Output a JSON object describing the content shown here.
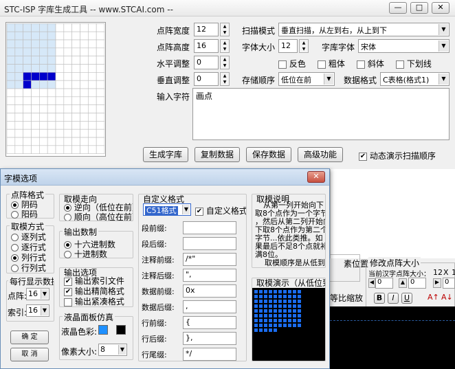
{
  "window": {
    "title": "STC-ISP 字库生成工具 -- www.STCAI.com --",
    "min": "—",
    "max": "□",
    "close": "✕"
  },
  "settings": {
    "width_label": "点阵宽度",
    "width_value": "12",
    "height_label": "点阵高度",
    "height_value": "16",
    "hadj_label": "水平调整",
    "hadj_value": "0",
    "vadj_label": "垂直调整",
    "vadj_value": "0",
    "scan_label": "扫描模式",
    "scan_value": "垂直扫描，从左到右，从上到下",
    "fontsize_label": "字体大小",
    "fontsize_value": "12",
    "font_label": "字库字体",
    "font_value": "宋体",
    "invert_label": "反色",
    "bold_label": "粗体",
    "italic_label": "斜体",
    "underline_label": "下划线",
    "order_label": "存储顺序",
    "order_value": "低位在前",
    "format_label": "数据格式",
    "format_value": "C表格(格式1)",
    "input_label": "输入字符",
    "input_value": "画点",
    "demo_scan_label": "动态演示扫描顺序",
    "demo_scan_checked": "✔"
  },
  "buttons": {
    "generate": "生成字库",
    "copy": "复制数据",
    "save": "保存数据",
    "advanced": "高级功能"
  },
  "behind": {
    "pixel_pos": "素位置",
    "modify_size": "修改点阵大小",
    "current_size": "当前汉字点阵大小：",
    "size_w": "12",
    "size_x": "X",
    "size_h": "1",
    "spin_val": "0",
    "ratio": "等比缩放",
    "b": "B",
    "i": "I",
    "u": "U"
  },
  "dialog": {
    "title": "字模选项",
    "close": "✕",
    "dot_format": {
      "title": "点阵格式",
      "options": [
        "阴码",
        "阳码"
      ]
    },
    "mode": {
      "title": "取模方式",
      "options": [
        "逐列式",
        "逐行式",
        "列行式",
        "行列式"
      ]
    },
    "per_line": {
      "title": "每行显示数据",
      "dot_label": "点阵:",
      "dot_value": "16",
      "index_label": "索引:",
      "index_value": "16"
    },
    "ok": "确 定",
    "cancel": "取 消",
    "direction": {
      "title": "取模走向",
      "options": [
        "逆向（低位在前）",
        "顺向（高位在前）"
      ]
    },
    "base": {
      "title": "输出数制",
      "options": [
        "十六进制数",
        "十进制数"
      ]
    },
    "output": {
      "title": "输出选项",
      "options": [
        "输出索引文件",
        "输出精简格式",
        "输出紧凑格式"
      ],
      "checked": [
        "✔",
        "✔",
        ""
      ]
    },
    "lcd": {
      "title": "液晶面板仿真",
      "color_label": "液晶色彩:",
      "color_a": "#1e90ff",
      "color_b": "#000000",
      "pixsize_label": "像素大小:",
      "pixsize_value": "8"
    },
    "custom": {
      "title": "自定义格式",
      "fmt_value": "C51格式",
      "custom_check_label": "自定义格式",
      "rows": [
        {
          "label": "段前缀:",
          "value": ""
        },
        {
          "label": "段后缀:",
          "value": ""
        },
        {
          "label": "注释前缀:",
          "value": "/*\""
        },
        {
          "label": "注释后缀:",
          "value": "\","
        },
        {
          "label": "数据前缀:",
          "value": "0x"
        },
        {
          "label": "数据后缀:",
          "value": ","
        },
        {
          "label": "行前缀:",
          "value": "{"
        },
        {
          "label": "行后缀:",
          "value": "},"
        },
        {
          "label": "行尾缀:",
          "value": "*/"
        }
      ]
    },
    "desc": {
      "title": "取模说明",
      "text": [
        "从第一列开始向下",
        "取8个点作为一个字节",
        "，然后从第二列开始向",
        "下取8个点作为第二个",
        "字节...依此类推。如",
        "果最后不足8个点就补",
        "满8位。"
      ],
      "footer": "取模顺序是从低到",
      "demo_title": "取模演示（从低位到高"
    }
  },
  "colors": {
    "accent": "#0000cc",
    "grid_hl": "#d6e8f8",
    "lcd_blue": "#1a6cf0"
  }
}
